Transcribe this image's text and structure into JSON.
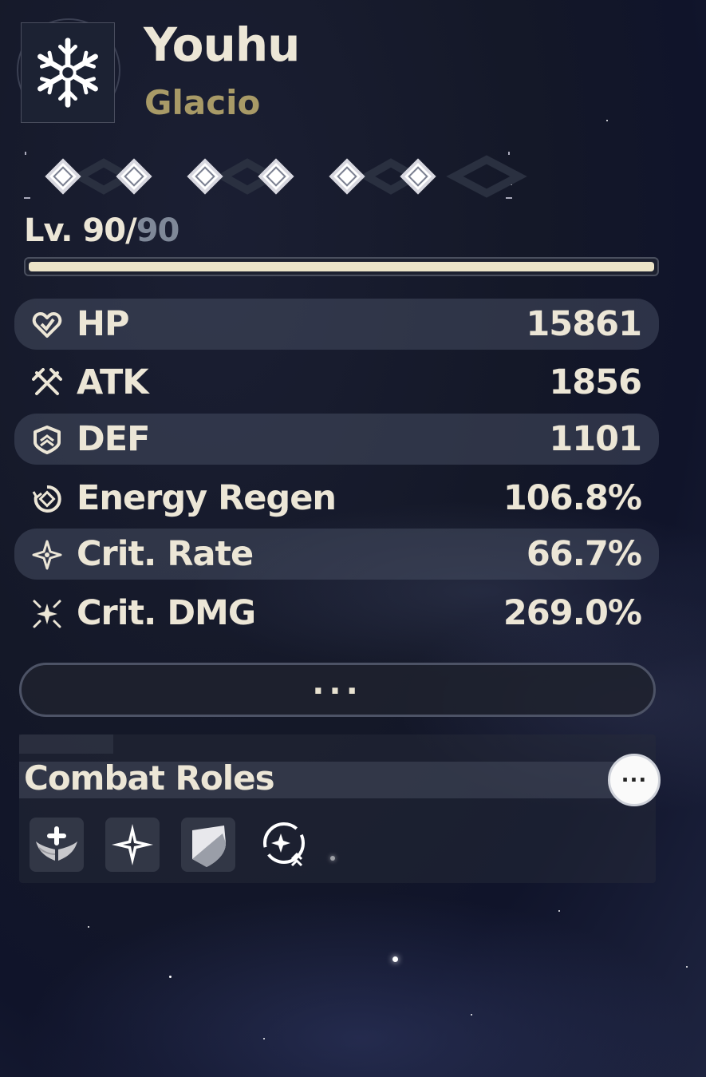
{
  "character": {
    "name": "Youhu",
    "attribute": "Glacio",
    "element_icon": "snowflake-icon"
  },
  "sequence": {
    "nodes": 6,
    "icon": "diamond-gem-icon"
  },
  "level": {
    "prefix": "Lv. 90/",
    "max": "90",
    "progress_fraction": 1.0
  },
  "stats": [
    {
      "label": "HP",
      "value": "15861",
      "icon": "hp-heart-icon"
    },
    {
      "label": "ATK",
      "value": "1856",
      "icon": "atk-swords-icon"
    },
    {
      "label": "DEF",
      "value": "1101",
      "icon": "def-shield-icon"
    },
    {
      "label": "Energy Regen",
      "value": "106.8%",
      "icon": "energy-regen-icon"
    },
    {
      "label": "Crit. Rate",
      "value": "66.7%",
      "icon": "crit-rate-icon"
    },
    {
      "label": "Crit. DMG",
      "value": "269.0%",
      "icon": "crit-dmg-icon"
    }
  ],
  "more_button": {
    "label": "..."
  },
  "combat_roles": {
    "title": "Combat Roles",
    "info_label": "...",
    "roles": [
      "healer-wings-icon",
      "star-burst-icon",
      "shield-icon",
      "concerto-cycle-icon"
    ]
  },
  "colors": {
    "text": "#ece6d6",
    "attribute": "#a89a67",
    "muted": "#7f8898",
    "row_shade": "#464c60"
  }
}
